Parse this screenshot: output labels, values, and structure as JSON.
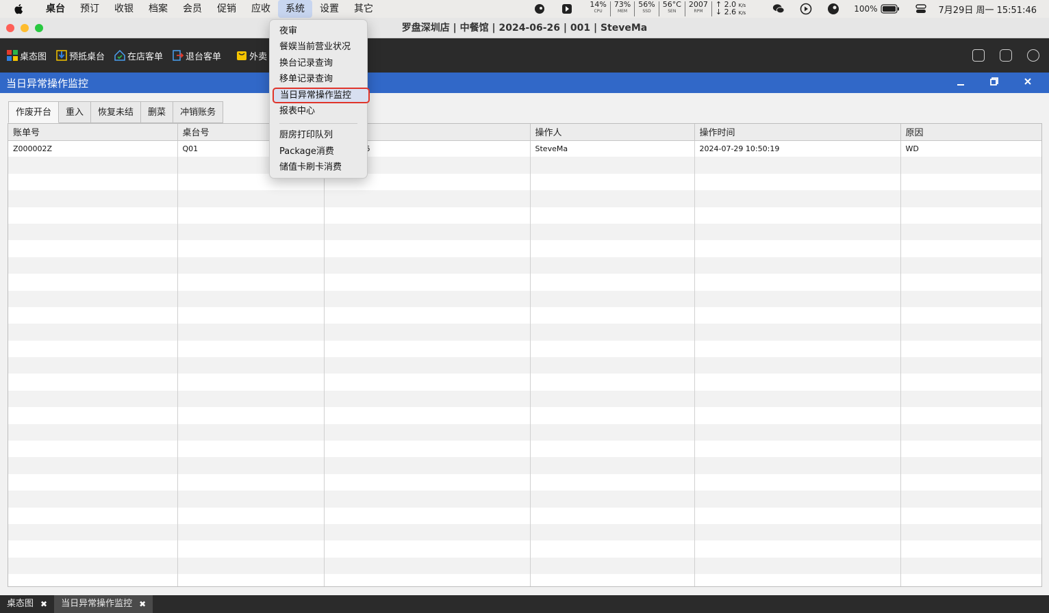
{
  "menubar": {
    "app": "桌台",
    "items": [
      "预订",
      "收银",
      "档案",
      "会员",
      "促销",
      "应收",
      "系统",
      "设置",
      "其它"
    ],
    "active": "系统",
    "stats": [
      {
        "value": "14%",
        "label": "CPU"
      },
      {
        "value": "73%",
        "label": "MEM"
      },
      {
        "value": "56%",
        "label": "SSD"
      },
      {
        "value": "56°C",
        "label": "SEN"
      },
      {
        "value": "2007",
        "label": "RPM"
      }
    ],
    "net_up": "2.0",
    "net_down": "2.6",
    "net_unit": "K/s",
    "battery": "100%",
    "datetime": "7月29日 周一  15:51:46"
  },
  "window": {
    "title": "罗盘深圳店 | 中餐馆 | 2024-06-26 | 001 | SteveMa"
  },
  "toolbar": {
    "buttons": [
      {
        "label": "桌态图",
        "icon": "grid-icon"
      },
      {
        "label": "预抵桌台",
        "icon": "arrival-icon"
      },
      {
        "label": "在店客单",
        "icon": "house-icon"
      },
      {
        "label": "退台客单",
        "icon": "exit-icon"
      },
      {
        "label": "外卖",
        "icon": "bag-icon"
      }
    ]
  },
  "panel": {
    "title": "当日异常操作监控",
    "tabs": [
      "作废开台",
      "重入",
      "恢复未结",
      "删菜",
      "冲销账务"
    ],
    "table": {
      "columns": [
        "账单号",
        "桌台号",
        "",
        "操作人",
        "操作时间",
        "原因"
      ],
      "rows": [
        [
          "Z000002Z",
          "Q01",
          "9 10:48:46",
          "SteveMa",
          "2024-07-29 10:50:19",
          "WD"
        ]
      ]
    }
  },
  "dropdown": {
    "items": [
      "夜审",
      "餐娱当前营业状况",
      "换台记录查询",
      "移单记录查询",
      "当日异常操作监控",
      "报表中心"
    ],
    "items2": [
      "厨房打印队列",
      "Package消费",
      "储值卡刷卡消费"
    ],
    "highlighted": "当日异常操作监控"
  },
  "bottom_tabs": [
    {
      "label": "桌态图",
      "close": "✖"
    },
    {
      "label": "当日异常操作监控",
      "close": "✖"
    }
  ]
}
